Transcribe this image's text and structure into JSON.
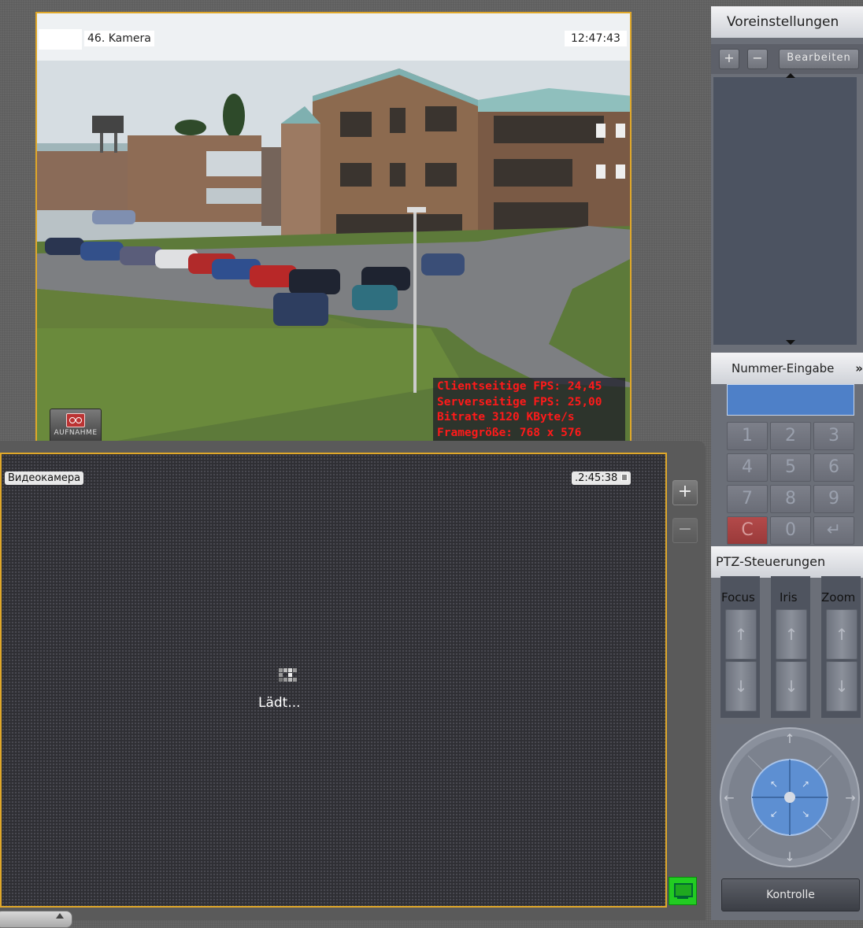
{
  "camera1": {
    "title": "46. Kamera",
    "time": "12:47:43",
    "record_label": "AUFNAHME",
    "stats": [
      "Clientseitige FPS: 24,45",
      "Serverseitige FPS: 25,00",
      "Bitrate 3120 KByte/s",
      "Framegröße: 768 x 576"
    ]
  },
  "camera2": {
    "title": "Видеокамера",
    "time": ".2:45:38",
    "loading_text": "Lädt...",
    "zoom_in": "+",
    "zoom_out": "−"
  },
  "side": {
    "presets_header": "Voreinstellungen",
    "add": "+",
    "remove": "−",
    "edit": "Bearbeiten",
    "number_header": "Nummer-Eingabe",
    "number_chevron": "»",
    "keys": [
      "1",
      "2",
      "3",
      "4",
      "5",
      "6",
      "7",
      "8",
      "9",
      "C",
      "0",
      "↵"
    ],
    "ptz_header": "PTZ-Steuerungen",
    "ptz_focus": "Focus",
    "ptz_iris": "Iris",
    "ptz_zoom": "Zoom",
    "arrow_up": "↑",
    "arrow_down": "↓",
    "control_button": "Kontrolle"
  },
  "colors": {
    "active_border": "#e0a82a",
    "stats_text": "#ff1a1a",
    "monitor_green": "#22cc22",
    "number_input": "#4e80c8"
  }
}
